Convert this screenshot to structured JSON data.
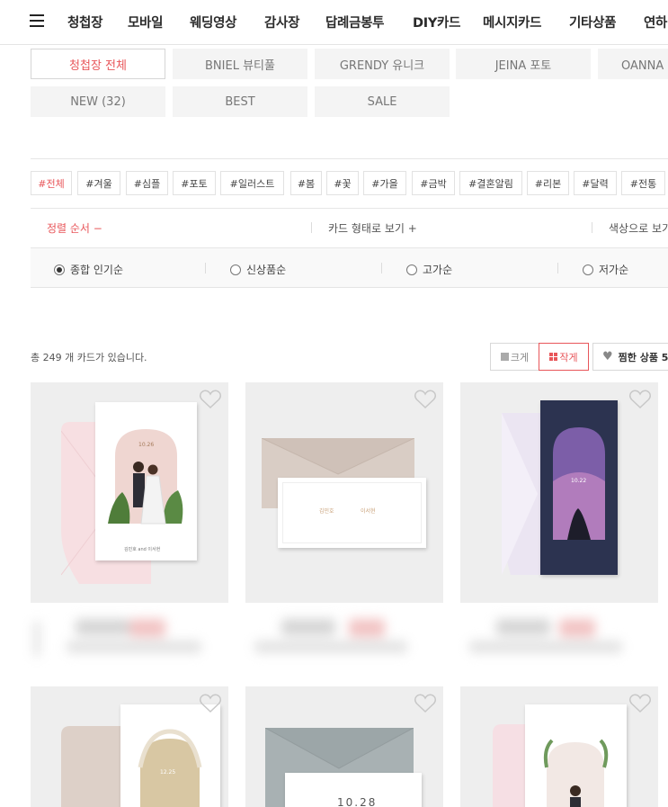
{
  "nav": {
    "items": [
      "청첩장",
      "모바일",
      "웨딩영상",
      "감사장",
      "답례금봉투",
      "DIY카드",
      "메시지카드",
      "기타상품",
      "연하"
    ]
  },
  "categories": [
    "청첩장 전체",
    "BNIEL 뷰티풀",
    "GRENDY 유니크",
    "JEINA 포토",
    "OANNA 꾸",
    "NEW (32)",
    "BEST",
    "SALE"
  ],
  "tags": [
    "#전체",
    "#겨울",
    "#심플",
    "#포토",
    "#일러스트",
    "#봄",
    "#꽃",
    "#가을",
    "#금박",
    "#결혼알림",
    "#리본",
    "#달력",
    "#전통"
  ],
  "filters": {
    "sort": "정렬 순서 −",
    "shape": "카드 형태로 보기 +",
    "color": "색상으로 보기"
  },
  "sort_options": [
    "종합 인기순",
    "신상품순",
    "고가순",
    "저가순"
  ],
  "count_text": "총 249 개 카드가 있습니다.",
  "view": {
    "large": "크게",
    "small": "작게"
  },
  "liked": "찜한 상품 5",
  "cards": [
    {
      "date": "10.26",
      "names": "김민호 and 이서현"
    },
    {
      "names_left": "김민호",
      "names_right": "이서현"
    },
    {
      "date": "10.22"
    },
    {
      "date": "12.25"
    },
    {
      "date": "10.28"
    },
    {}
  ],
  "colors": {
    "accent": "#e8565a",
    "heart": "#cccccc"
  }
}
